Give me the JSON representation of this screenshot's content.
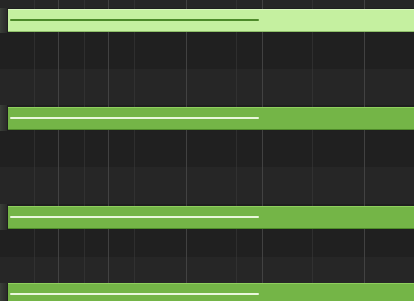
{
  "piano_roll": {
    "colors": {
      "background": "#1f1f1f",
      "note_fill": "#74b547",
      "note_selected_fill": "#c5f0a0",
      "velocity_line": "#e9f7dc",
      "grid_line": "#3a3a3a"
    },
    "notes": [
      {
        "id": "note-1",
        "selected": true,
        "velocity": 0.62
      },
      {
        "id": "note-2",
        "selected": false,
        "velocity": 0.62
      },
      {
        "id": "note-3",
        "selected": false,
        "velocity": 0.62
      },
      {
        "id": "note-4",
        "selected": false,
        "velocity": 0.62
      }
    ]
  }
}
